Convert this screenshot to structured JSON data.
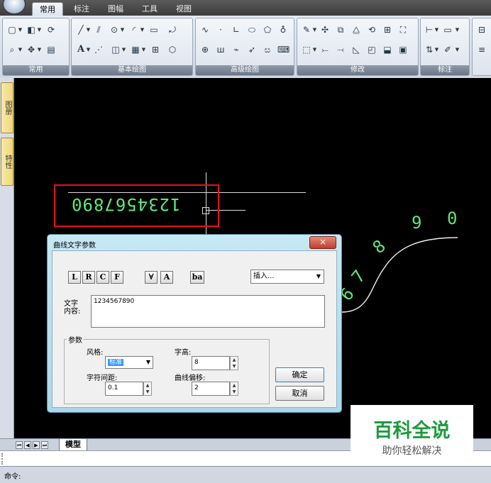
{
  "ribbon": {
    "tabs": [
      "常用",
      "标注",
      "图幅",
      "工具",
      "视图"
    ],
    "groups": [
      "常用",
      "基本绘图",
      "高级绘图",
      "修改",
      "标注"
    ],
    "text_tool_label": "A"
  },
  "side_tabs": [
    "图册",
    "特性"
  ],
  "canvas": {
    "mirrored_text": "1234567890",
    "curve_glyphs": [
      "6",
      "7",
      "8",
      "9",
      "0"
    ]
  },
  "dialog": {
    "title": "曲线文字参数",
    "close_label": "×",
    "align_buttons": [
      "L",
      "R",
      "C",
      "F"
    ],
    "flip_buttons": [
      "∀",
      "A",
      "ba"
    ],
    "insert_select_value": "插入...",
    "content_label": "文字\n内容:",
    "content_value": "1234567890",
    "params_group_label": "参数",
    "style_label": "风格:",
    "style_value": "标准",
    "height_label": "字高:",
    "height_value": "8",
    "spacing_label": "字符间距:",
    "spacing_value": "0.1",
    "offset_label": "曲线偏移:",
    "offset_value": "2",
    "ok_label": "确定",
    "cancel_label": "取消"
  },
  "layout": {
    "model_tab": "模型"
  },
  "command": {
    "prompt": "命令:"
  },
  "watermark": {
    "title": "百科全说",
    "subtitle": "助你轻松解决"
  }
}
